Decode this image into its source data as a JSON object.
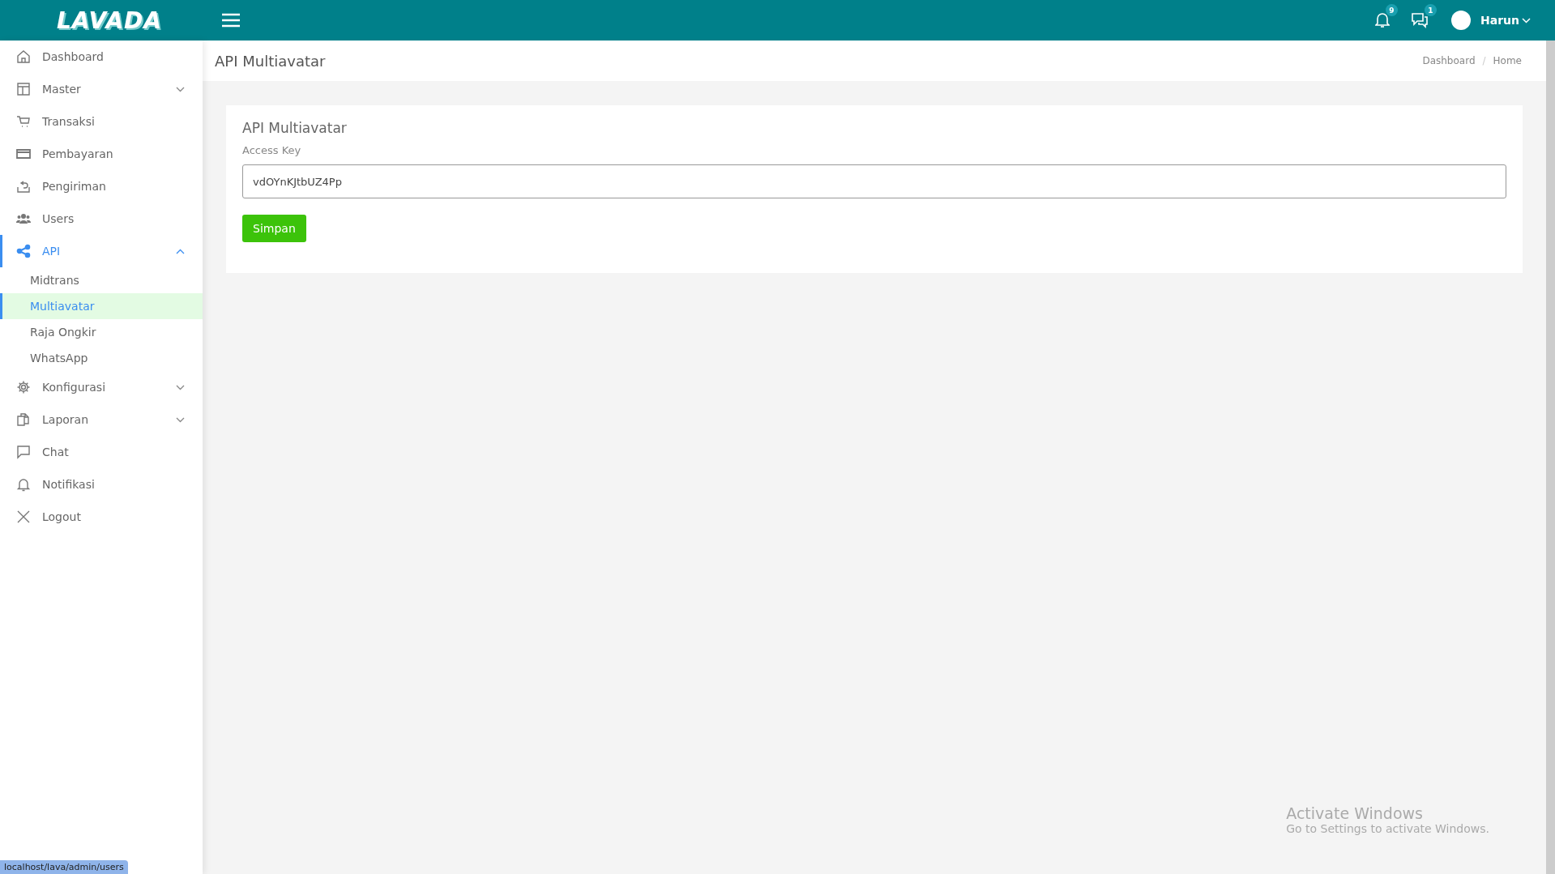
{
  "header": {
    "logo": "LAVADA",
    "notifications": {
      "count": "9"
    },
    "messages": {
      "count": "1"
    },
    "user": {
      "name": "Harun"
    }
  },
  "sidebar": {
    "items": [
      {
        "label": "Dashboard",
        "selected": false
      },
      {
        "label": "Master",
        "selected": false,
        "expanded": false
      },
      {
        "label": "Transaksi",
        "selected": false
      },
      {
        "label": "Pembayaran",
        "selected": false
      },
      {
        "label": "Pengiriman",
        "selected": false
      },
      {
        "label": "Users",
        "selected": false
      },
      {
        "label": "API",
        "selected": true,
        "expanded": true,
        "children": [
          {
            "label": "Midtrans",
            "selected": false
          },
          {
            "label": "Multiavatar",
            "selected": true
          },
          {
            "label": "Raja Ongkir",
            "selected": false
          },
          {
            "label": "WhatsApp",
            "selected": false
          }
        ]
      },
      {
        "label": "Konfigurasi",
        "selected": false,
        "expanded": false
      },
      {
        "label": "Laporan",
        "selected": false,
        "expanded": false
      },
      {
        "label": "Chat",
        "selected": false
      },
      {
        "label": "Notifikasi",
        "selected": false
      },
      {
        "label": "Logout",
        "selected": false
      }
    ]
  },
  "page_header": {
    "title": "API Multiavatar",
    "breadcrumb": [
      "Dashboard",
      "Home"
    ],
    "breadcrumb_separator": "/"
  },
  "card": {
    "title": "API Multiavatar",
    "field": {
      "label": "Access Key",
      "value": "vdOYnKJtbUZ4Pp"
    },
    "button": "Simpan"
  },
  "status_url": "localhost/lava/admin/users",
  "os_notice": {
    "title": "Activate Windows",
    "text": "Go to Settings to activate Windows."
  }
}
